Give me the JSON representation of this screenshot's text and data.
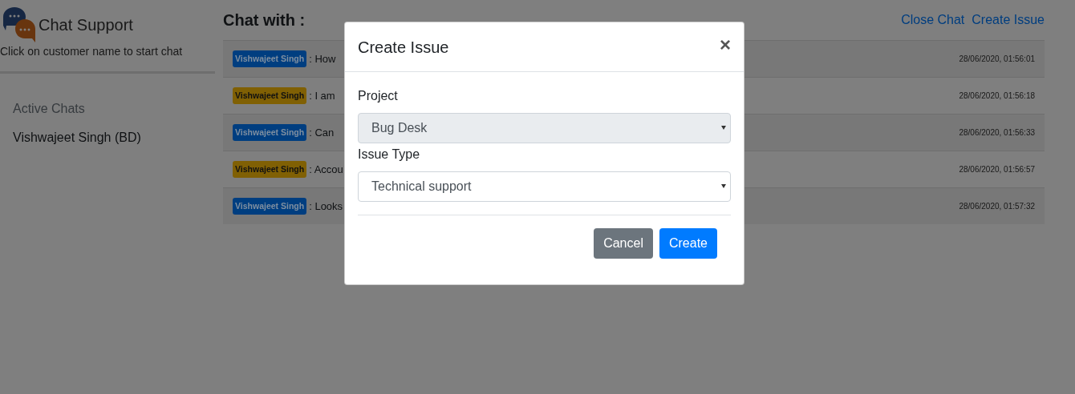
{
  "sidebar": {
    "title": "Chat Support",
    "hint": "Click on customer name to start chat",
    "section_title": "Active Chats",
    "chats": [
      {
        "name": "Vishwajeet Singh (BD)"
      }
    ]
  },
  "chat": {
    "heading": "Chat with :",
    "links": [
      "Close Chat",
      "Create Issue"
    ],
    "messages": [
      {
        "sender": "Vishwajeet Singh",
        "color": "#003e80",
        "text": ": How",
        "time": "28/06/2020, 01:56:01"
      },
      {
        "sender": "Vishwajeet Singh",
        "color": "#806004",
        "text": ": I am",
        "time": "28/06/2020, 01:56:18"
      },
      {
        "sender": "Vishwajeet Singh",
        "color": "#003e80",
        "text": ": Can",
        "time": "28/06/2020, 01:56:33"
      },
      {
        "sender": "Vishwajeet Singh",
        "color": "#806004",
        "text": ": Accou",
        "time": "28/06/2020, 01:56:57"
      },
      {
        "sender": "Vishwajeet Singh",
        "color": "#003e80",
        "text": ": Looks",
        "time": "28/06/2020, 01:57:32"
      }
    ]
  },
  "modal": {
    "title": "Create Issue",
    "close": "×",
    "fields": [
      {
        "label": "Project",
        "value": "Bug Desk",
        "disabled": true
      },
      {
        "label": "Issue Type",
        "value": "Technical support",
        "disabled": false
      }
    ],
    "buttons": [
      {
        "label": "Cancel",
        "kind": "secondary"
      },
      {
        "label": "Create",
        "kind": "primary"
      }
    ]
  }
}
